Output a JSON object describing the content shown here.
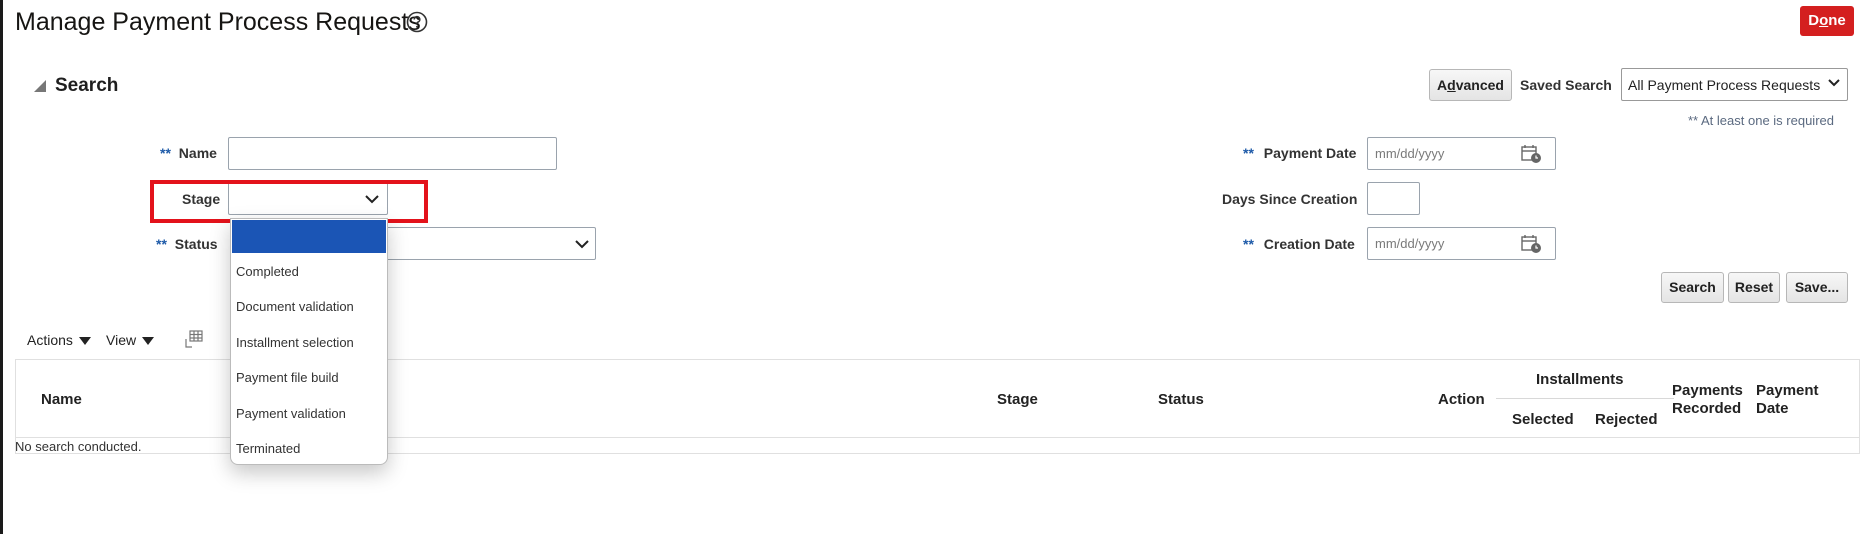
{
  "page": {
    "title": "Manage Payment Process Requests",
    "done_label": "Done",
    "accent_color": "#d41f1f"
  },
  "search": {
    "heading": "Search",
    "advanced_label": "Advanced",
    "saved_search_label": "Saved Search",
    "saved_search_value": "All Payment Process Requests",
    "required_note": "** At least one is required",
    "required_marker": "**",
    "fields": {
      "name_label": "Name",
      "name_value": "",
      "stage_label": "Stage",
      "stage_value": "",
      "status_label": "Status",
      "status_value": "",
      "payment_date_label": "Payment Date",
      "payment_date_placeholder": "mm/dd/yyyy",
      "days_since_creation_label": "Days Since Creation",
      "days_since_creation_value": "",
      "creation_date_label": "Creation Date",
      "creation_date_placeholder": "mm/dd/yyyy"
    },
    "buttons": {
      "search": "Search",
      "reset": "Reset",
      "save": "Save..."
    }
  },
  "stage_dropdown": {
    "options": [
      "",
      "Completed",
      "Document validation",
      "Installment selection",
      "Payment file build",
      "Payment validation",
      "Terminated"
    ],
    "highlighted_index": 0,
    "highlight_color": "#1b55b5"
  },
  "results": {
    "toolbar": {
      "actions_label": "Actions",
      "view_label": "View"
    },
    "columns": {
      "name": "Name",
      "stage": "Stage",
      "status": "Status",
      "action": "Action",
      "installments": "Installments",
      "selected": "Selected",
      "rejected": "Rejected",
      "payments_recorded_1": "Payments",
      "payments_recorded_2": "Recorded",
      "payment_date_1": "Payment",
      "payment_date_2": "Date"
    },
    "empty_message": "No search conducted."
  },
  "icons": {
    "help": "help-circle-icon",
    "collapse": "collapse-triangle-icon",
    "calendar": "calendar-icon",
    "chevron": "chevron-down-icon",
    "detach": "detach-table-icon"
  }
}
